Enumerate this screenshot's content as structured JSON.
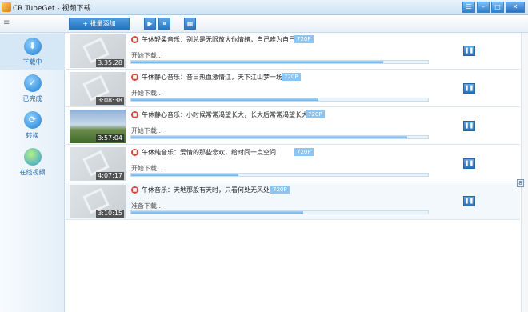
{
  "window": {
    "title": "CR TubeGet - 视频下载"
  },
  "toolbar": {
    "batch_label": "+ 批量添加",
    "play_glyph": "▶",
    "pause_glyph": "⏸",
    "settings_glyph": "▦"
  },
  "sidebar": {
    "items": [
      {
        "label": "下载中",
        "icon": "download-icon",
        "glyph": "⬇"
      },
      {
        "label": "已完成",
        "icon": "check-icon",
        "glyph": "✓"
      },
      {
        "label": "转换",
        "icon": "convert-icon",
        "glyph": "⟳"
      },
      {
        "label": "在线视频",
        "icon": "globe-icon",
        "glyph": ""
      }
    ]
  },
  "downloads": [
    {
      "title": "午休轻柔音乐：别总是无限放大你情绪，自己难为自己",
      "quality": "720P",
      "duration": "3:35:28",
      "status": "开始下载...",
      "progress": 0.85
    },
    {
      "title": "午休静心音乐：昔日热血激情江，天下江山梦一场",
      "quality": "720P",
      "duration": "3:08:38",
      "status": "开始下载...",
      "progress": 0.63
    },
    {
      "title": "午休静心音乐：小时候常常渴望长大，长大后常常渴望长大",
      "quality": "720P",
      "duration": "3:57:04",
      "status": "开始下载...",
      "progress": 0.93
    },
    {
      "title": "午休纯音乐：爱情的那些悲欢，给时间一点空间",
      "quality": "720P",
      "duration": "4:07:17",
      "status": "开始下载...",
      "progress": 0.36
    },
    {
      "title": "午休音乐：天地那般有天时，只看何处无风处",
      "quality": "720P",
      "duration": "3:10:15",
      "status": "准备下载...",
      "progress": 0.58
    }
  ],
  "colors": {
    "accent": "#2c72bd",
    "progress": "#6fb3ec",
    "stop": "#e0413a"
  }
}
